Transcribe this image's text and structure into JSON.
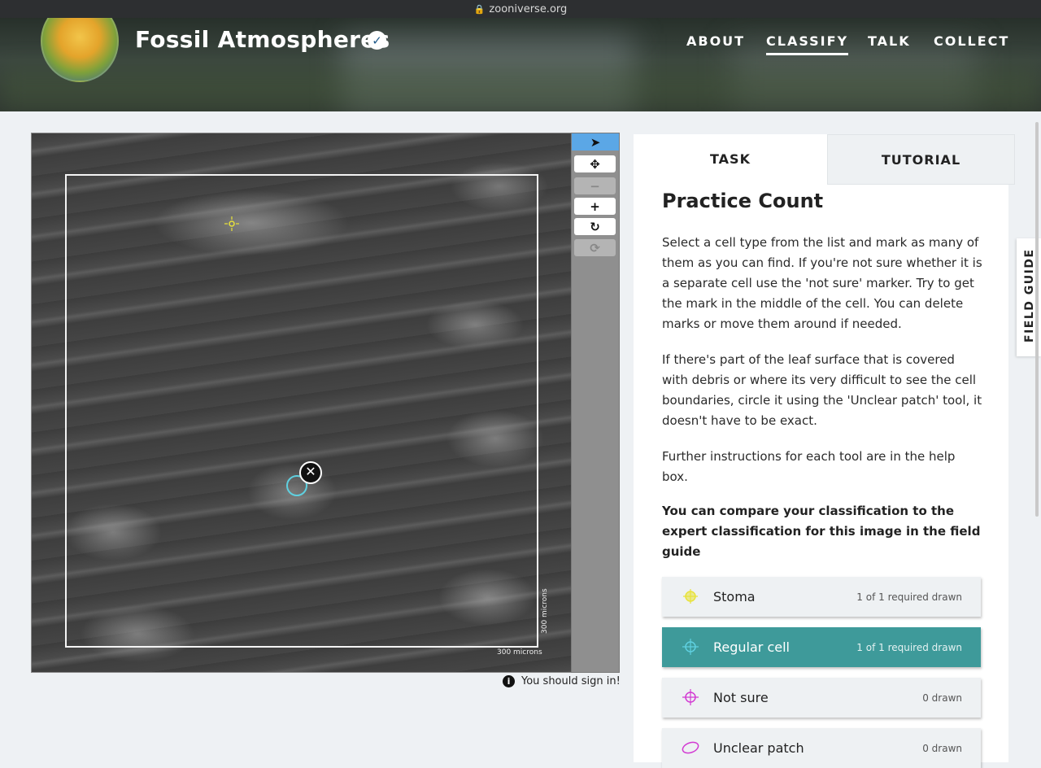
{
  "browser": {
    "url": "zooniverse.org"
  },
  "header": {
    "title": "Fossil Atmospheres",
    "nav": [
      {
        "label": "ABOUT",
        "active": false
      },
      {
        "label": "CLASSIFY",
        "active": true
      },
      {
        "label": "TALK",
        "active": false
      },
      {
        "label": "COLLECT",
        "active": false
      }
    ]
  },
  "viewer": {
    "scale_x_label": "300 microns",
    "scale_y_label": "300 microns",
    "toolbar": [
      {
        "name": "select-pointer",
        "icon": "arrow-pointer-icon",
        "glyph": "➤",
        "active": true
      },
      {
        "name": "pan",
        "icon": "move-arrows-icon",
        "glyph": "✥",
        "active": false
      },
      {
        "name": "zoom-out",
        "icon": "minus-icon",
        "glyph": "−",
        "active": false,
        "disabled": true
      },
      {
        "name": "zoom-in",
        "icon": "plus-icon",
        "glyph": "+",
        "active": false
      },
      {
        "name": "rotate",
        "icon": "rotate-icon",
        "glyph": "↻",
        "active": false
      },
      {
        "name": "reset",
        "icon": "refresh-icon",
        "glyph": "⟳",
        "active": false,
        "disabled": true
      }
    ],
    "sign_in_notice": "You should sign in!"
  },
  "task_panel": {
    "tabs": {
      "task": "TASK",
      "tutorial": "TUTORIAL"
    },
    "title": "Practice Count",
    "paragraphs": [
      "Select a cell type from the list and mark as many of them as you can find. If you're not sure whether it is a separate cell use the 'not sure' marker. Try to get the mark in the middle of the cell. You can delete marks or move them around if needed.",
      "If there's part of the leaf surface that is covered with debris or where its very difficult to see the cell boundaries, circle it using the 'Unclear patch' tool, it doesn't have to be exact.",
      "Further instructions for each tool are in the help box."
    ],
    "bold_note": "You can compare your classification to the expert classification for this image in the field guide",
    "tools": [
      {
        "label": "Stoma",
        "count": "1 of 1 required drawn",
        "icon": "stoma-crosshair-icon",
        "color": "#e8e23a",
        "selected": false
      },
      {
        "label": "Regular cell",
        "count": "1 of 1 required drawn",
        "icon": "crosshair-icon",
        "color": "#5fd0e0",
        "selected": true
      },
      {
        "label": "Not sure",
        "count": "0 drawn",
        "icon": "crosshair-icon",
        "color": "#d23ad2",
        "selected": false
      },
      {
        "label": "Unclear patch",
        "count": "0 drawn",
        "icon": "ellipse-icon",
        "color": "#d23ad2",
        "selected": false
      }
    ]
  },
  "field_guide": {
    "label": "FIELD GUIDE"
  }
}
